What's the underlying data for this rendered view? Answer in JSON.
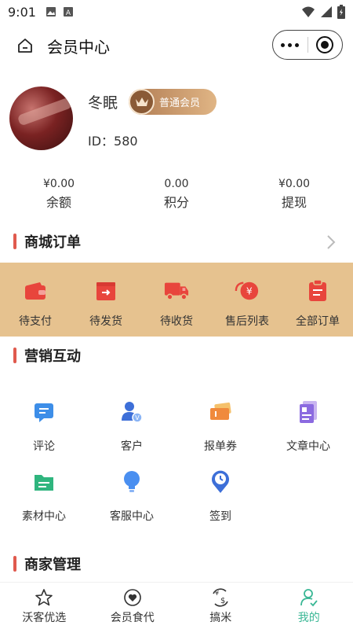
{
  "status_bar": {
    "time": "9:01"
  },
  "nav": {
    "title": "会员中心"
  },
  "profile": {
    "nickname": "冬眠",
    "badge": "普通会员",
    "id_text": "ID：580"
  },
  "stats": [
    {
      "value": "¥0.00",
      "label": "余额"
    },
    {
      "value": "0.00",
      "label": "积分"
    },
    {
      "value": "¥0.00",
      "label": "提现"
    }
  ],
  "orders_section": {
    "title": "商城订单"
  },
  "orders": [
    {
      "label": "待支付",
      "icon": "wallet-icon"
    },
    {
      "label": "待发货",
      "icon": "package-out-icon"
    },
    {
      "label": "待收货",
      "icon": "truck-icon"
    },
    {
      "label": "售后列表",
      "icon": "yuan-coin-icon"
    },
    {
      "label": "全部订单",
      "icon": "clipboard-icon"
    }
  ],
  "marketing_section": {
    "title": "营销互动"
  },
  "marketing": [
    {
      "label": "评论",
      "icon": "comment-icon"
    },
    {
      "label": "客户",
      "icon": "customer-icon"
    },
    {
      "label": "报单券",
      "icon": "ticket-icon"
    },
    {
      "label": "文章中心",
      "icon": "article-icon"
    },
    {
      "label": "素材中心",
      "icon": "folder-icon"
    },
    {
      "label": "客服中心",
      "icon": "lightbulb-icon"
    },
    {
      "label": "签到",
      "icon": "checkin-pin-icon"
    }
  ],
  "merchant_section": {
    "title": "商家管理"
  },
  "tabs": [
    {
      "label": "沃客优选",
      "icon": "star-icon",
      "active": false
    },
    {
      "label": "会员食代",
      "icon": "heart-circle-icon",
      "active": false
    },
    {
      "label": "搞米",
      "icon": "money-cycle-icon",
      "active": false
    },
    {
      "label": "我的",
      "icon": "user-check-icon",
      "active": true
    }
  ],
  "colors": {
    "accent_green": "#3ab795",
    "order_bg": "#e6c28f",
    "order_icon_red": "#e8453c",
    "section_bar": "#e05a4e"
  }
}
